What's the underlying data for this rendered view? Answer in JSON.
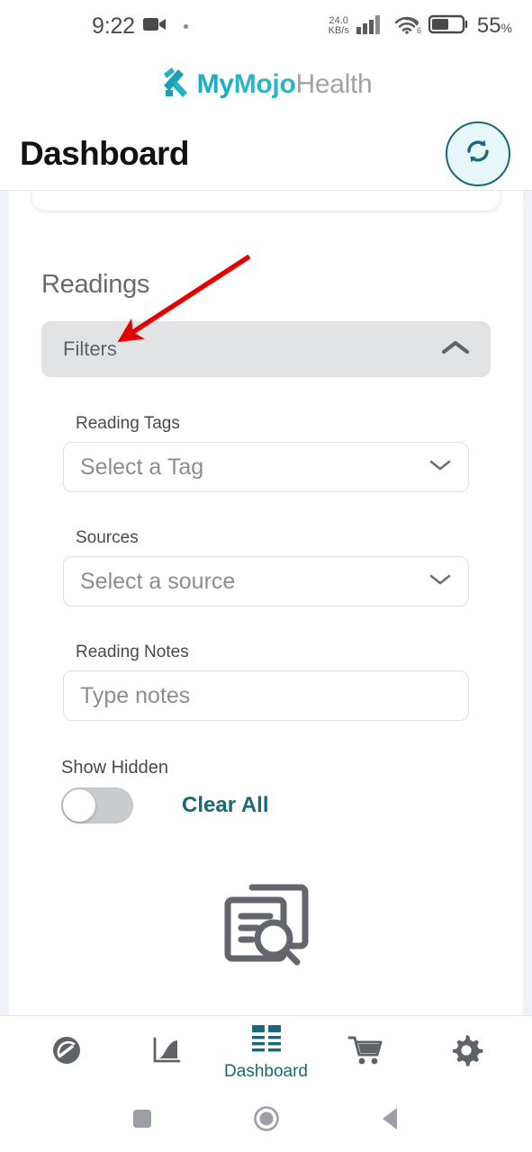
{
  "statusbar": {
    "time": "9:22",
    "video_icon": "video-camera-icon",
    "network_speed_value": "24.0",
    "network_speed_unit": "KB/s",
    "signal_icon": "cellular-signal-icon",
    "wifi_icon": "wifi-6-icon",
    "wifi_generation": "6",
    "battery_icon": "battery-icon",
    "battery_percent": "55",
    "battery_percent_symbol": "%"
  },
  "brand": {
    "part_my": "My",
    "part_mojo": "Mojo",
    "part_health": "Health",
    "logo_icon": "mymojohealth-logo-icon",
    "teal": "#1aaec4",
    "gray": "#a3a3a3"
  },
  "header": {
    "title": "Dashboard",
    "refresh_icon": "refresh-sync-icon",
    "accent": "#17697a"
  },
  "readings": {
    "section_title": "Readings",
    "filters": {
      "label": "Filters",
      "chevron_icon": "chevron-up-icon",
      "expanded": true
    },
    "fields": [
      {
        "label": "Reading Tags",
        "placeholder": "Select a Tag",
        "value": "",
        "type": "select",
        "icon": "chevron-down-icon"
      },
      {
        "label": "Sources",
        "placeholder": "Select a source",
        "value": "",
        "type": "select",
        "icon": "chevron-down-icon"
      },
      {
        "label": "Reading Notes",
        "placeholder": "Type notes",
        "value": "",
        "type": "text",
        "icon": ""
      }
    ],
    "show_hidden": {
      "label": "Show Hidden",
      "state": "off"
    },
    "clear_all": "Clear All",
    "empty_state_icon": "document-search-icon"
  },
  "annotation": {
    "type": "arrow",
    "color": "#e60000",
    "points_to": "filters-bar"
  },
  "bottom_nav": {
    "items": [
      {
        "icon": "gauge-icon",
        "label": "",
        "active": false
      },
      {
        "icon": "chart-icon",
        "label": "",
        "active": false
      },
      {
        "icon": "dashboard-icon",
        "label": "Dashboard",
        "active": true
      },
      {
        "icon": "cart-icon",
        "label": "",
        "active": false
      },
      {
        "icon": "gear-icon",
        "label": "",
        "active": false
      }
    ],
    "active_color": "#17697a",
    "inactive_color": "#5f6368"
  },
  "android_nav": {
    "recents": "square-recents-icon",
    "home": "circle-home-icon",
    "back": "triangle-back-icon"
  }
}
